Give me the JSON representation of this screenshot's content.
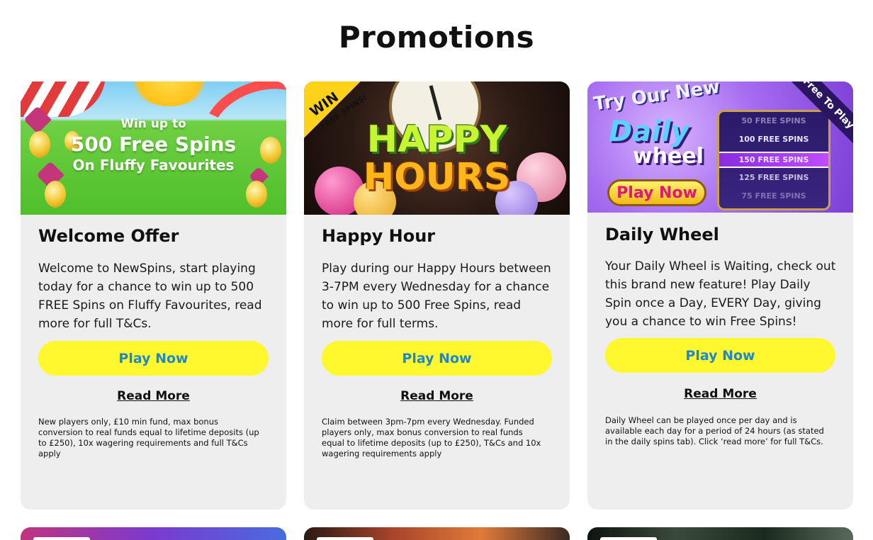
{
  "page": {
    "title": "Promotions"
  },
  "cards": [
    {
      "title": "Welcome Offer",
      "description": "Welcome to NewSpins, start playing today for a chance to win up to 500 FREE Spins on Fluffy Favourites, read more for full T&Cs.",
      "play_label": "Play Now",
      "read_more_label": "Read More",
      "terms": "New players only, £10 min fund, max bonus conversion to real funds equal to lifetime deposits (up to £250), 10x wagering requirements and full T&Cs apply",
      "banner": {
        "line1": "Win up to",
        "line2": "500 Free Spins",
        "line3": "On Fluffy Favourites"
      }
    },
    {
      "title": "Happy Hour",
      "description": "Play during our Happy Hours between 3-7PM every Wednesday for a chance to win up to 500 Free Spins, read more for full terms.",
      "play_label": "Play Now",
      "read_more_label": "Read More",
      "terms": "Claim between 3pm-7pm every Wednesday. Funded players only, max bonus conversion to real funds equal to lifetime deposits (up to £250), T&Cs and 10x wagering requirements apply",
      "banner": {
        "ribbon1": "WIN",
        "ribbon2": "FREE SPINS!",
        "line1": "HAPPY",
        "line2": "HOURS"
      }
    },
    {
      "title": "Daily Wheel",
      "description": "Your Daily Wheel is Waiting, check out this brand new feature! Play Daily Spin once a Day, EVERY Day, giving you a chance to win Free Spins!",
      "play_label": "Play Now",
      "read_more_label": "Read More",
      "terms": "Daily Wheel can be played once per day and is available each day for a period of 24 hours (as stated in the daily spins tab). Click ‘read more’ for full T&Cs.",
      "banner": {
        "try": "Try Our New",
        "daily": "Daily",
        "wheel": "wheel",
        "play": "Play Now",
        "corner": "Free To Play",
        "rows": [
          "50 FREE SPINS",
          "100 FREE SPINS",
          "150 FREE SPINS",
          "125 FREE SPINS",
          "75 FREE SPINS"
        ]
      }
    }
  ],
  "colors": {
    "play_button_bg": "#fff82e",
    "play_button_text": "#1e88c8",
    "card_bg": "#eeeeee"
  }
}
